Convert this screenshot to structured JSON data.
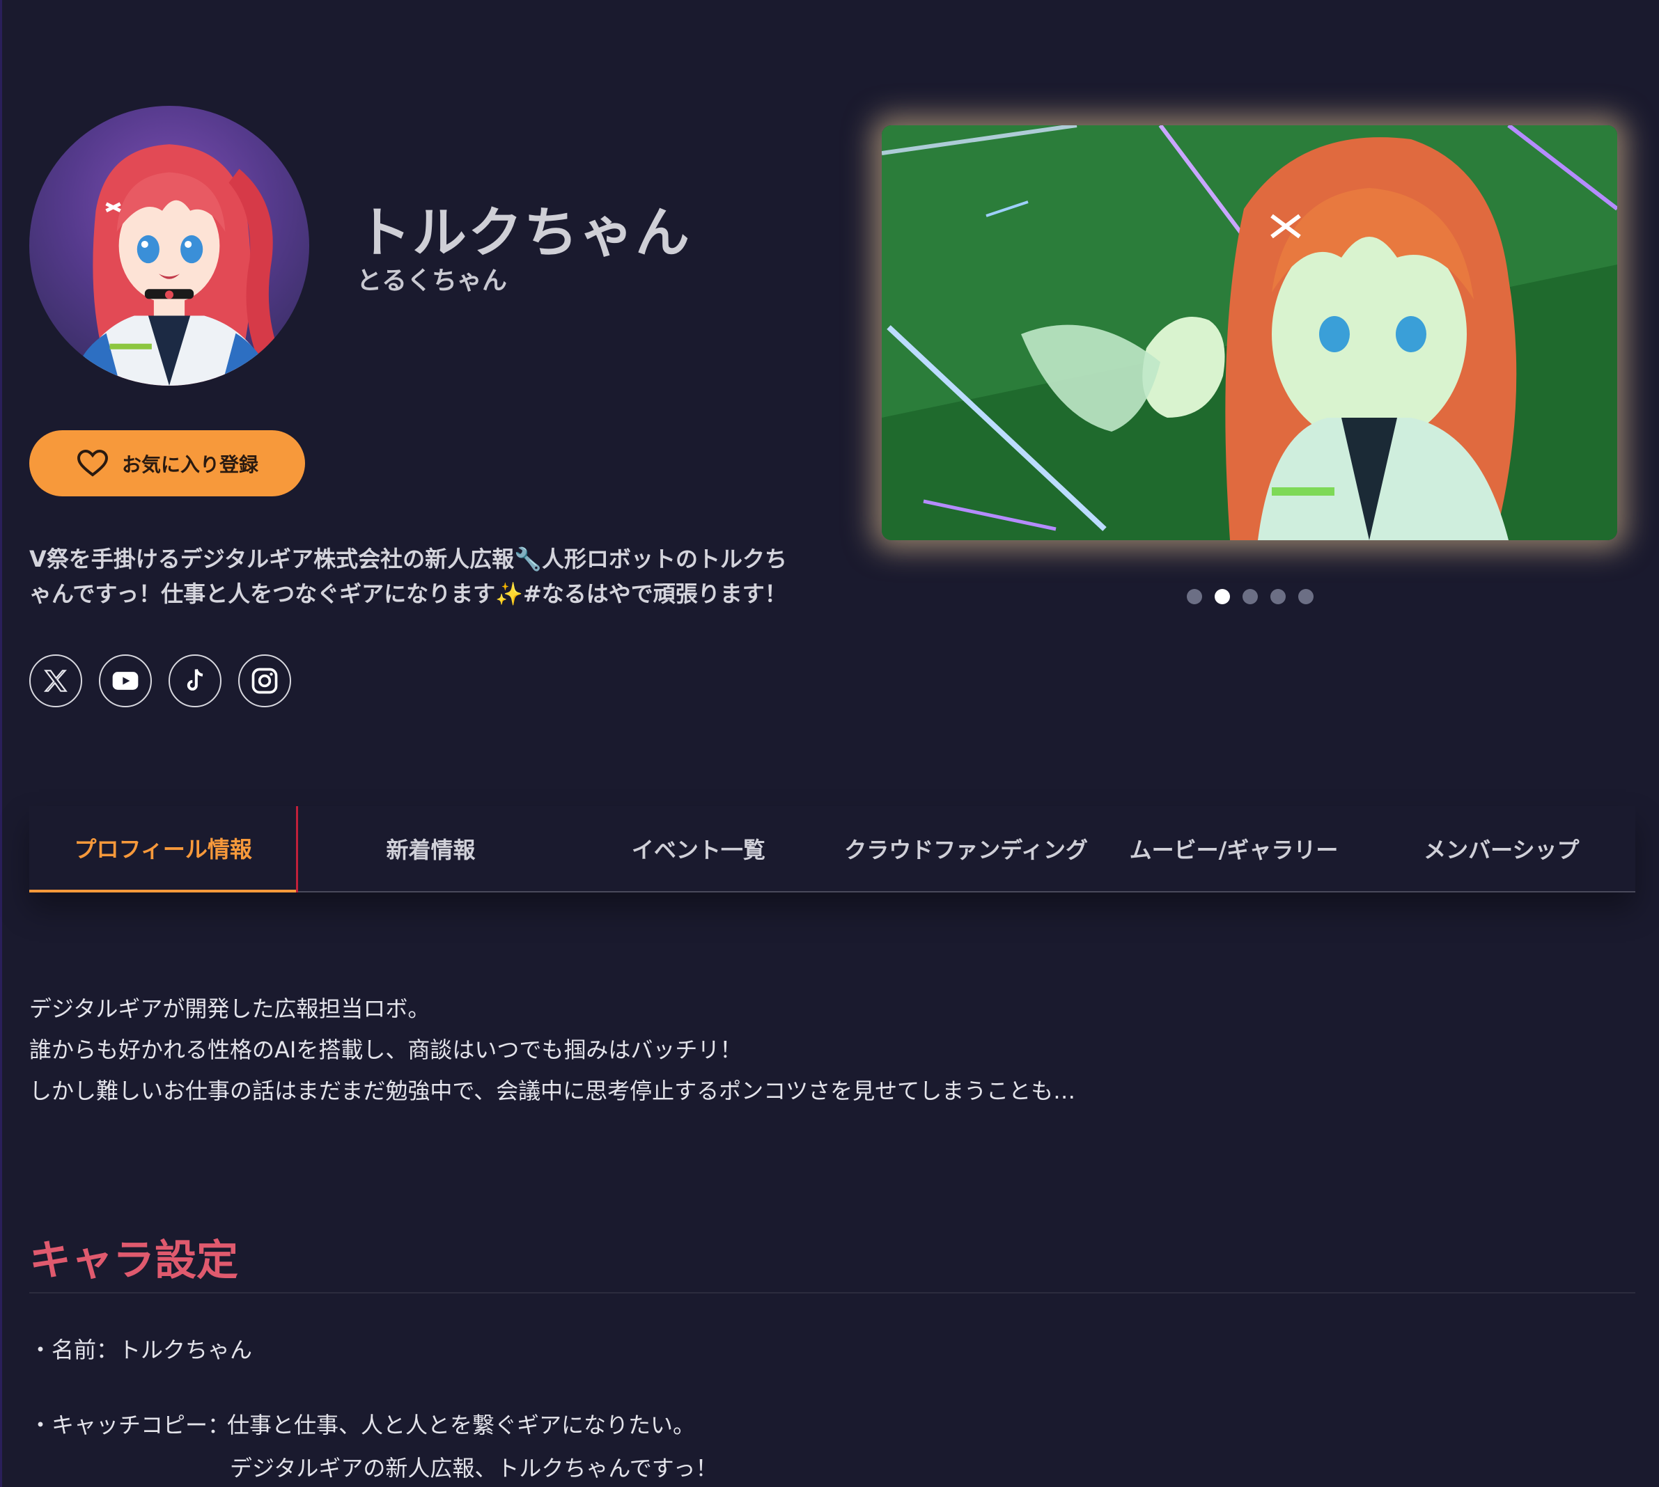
{
  "profile": {
    "name": "トルクちゃん",
    "kana": "とるくちゃん",
    "favorite_label": "お気に入り登録",
    "description_line1": "V祭を手掛けるデジタルギア株式会社の新人広報🔧人形ロボットのトルクち",
    "description_line2": "ゃんですっ！仕事と人をつなぐギアになります✨#なるはやで頑張ります！"
  },
  "socials": [
    {
      "name": "x-icon"
    },
    {
      "name": "youtube-icon"
    },
    {
      "name": "tiktok-icon"
    },
    {
      "name": "instagram-icon"
    }
  ],
  "carousel": {
    "count": 5,
    "active_index": 1
  },
  "tabs": [
    {
      "label": "プロフィール情報",
      "active": true
    },
    {
      "label": "新着情報"
    },
    {
      "label": "イベント一覧"
    },
    {
      "label": "クラウドファンディング"
    },
    {
      "label": "ムービー/ギャラリー"
    },
    {
      "label": "メンバーシップ"
    }
  ],
  "intro": {
    "line1": "デジタルギアが開発した広報担当ロボ。",
    "line2": "誰からも好かれる性格のAIを搭載し、商談はいつでも掴みはバッチリ！",
    "line3": "しかし難しいお仕事の話はまだまだ勉強中で、会議中に思考停止するポンコツさを見せてしまうことも…"
  },
  "settings": {
    "title": "キャラ設定",
    "name_item": "・名前：トルクちゃん",
    "catchcopy_label": "・キャッチコピー：",
    "catchcopy_line1": "仕事と仕事、人と人とを繋ぐギアになりたい。",
    "catchcopy_line2": "デジタルギアの新人広報、トルクちゃんですっ！"
  },
  "colors": {
    "background": "#1a1a2e",
    "accent": "#f7993b",
    "section_title": "#e05a6e"
  }
}
